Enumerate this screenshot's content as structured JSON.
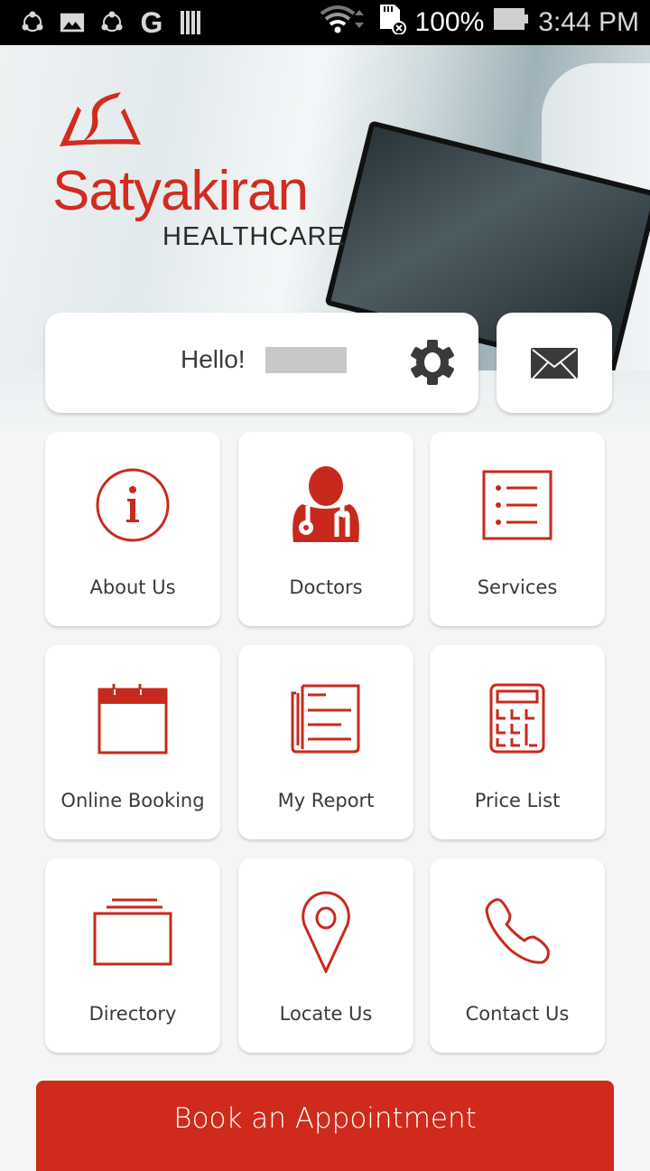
{
  "status_bar": {
    "left_icons": [
      "share-it-icon",
      "gallery-icon",
      "share-it-icon",
      "google-icon",
      "barcode-icon"
    ],
    "battery_percent": "100%",
    "time": "3:44 PM"
  },
  "brand": {
    "name": "Satyakiran",
    "subtitle": "HEALTHCARE",
    "accent_color": "#d22b1f"
  },
  "greeting": {
    "text": "Hello!",
    "user_name_redacted": true
  },
  "menu": {
    "tiles": [
      {
        "label": "About Us",
        "icon": "info-icon"
      },
      {
        "label": "Doctors",
        "icon": "doctor-icon"
      },
      {
        "label": "Services",
        "icon": "list-icon"
      },
      {
        "label": "Online Booking",
        "icon": "calendar-icon"
      },
      {
        "label": "My Report",
        "icon": "report-icon"
      },
      {
        "label": "Price List",
        "icon": "calculator-icon"
      },
      {
        "label": "Directory",
        "icon": "folder-stack-icon"
      },
      {
        "label": "Locate Us",
        "icon": "location-pin-icon"
      },
      {
        "label": "Contact Us",
        "icon": "phone-icon"
      }
    ]
  },
  "cta": {
    "label": "Book an Appointment",
    "color": "#cf2a1c"
  }
}
